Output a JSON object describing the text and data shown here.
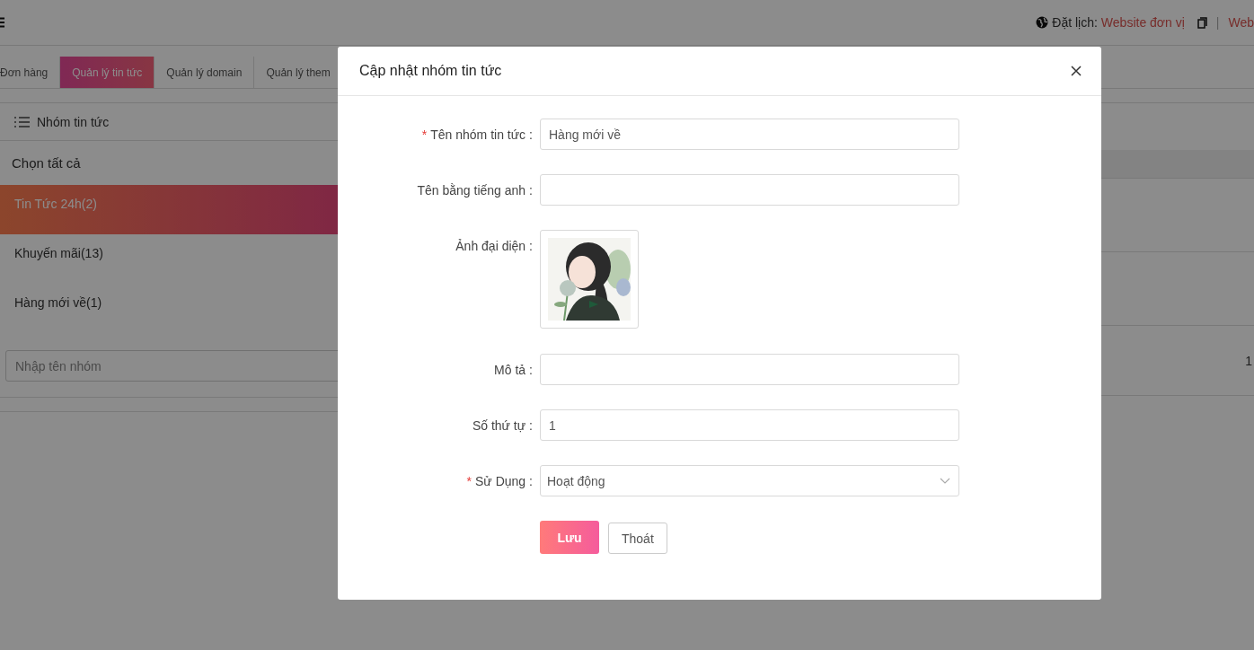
{
  "header": {
    "schedule_label": "Đặt lịch:",
    "schedule_link": "Website đơn vị",
    "separator": "|",
    "link_2": "Web"
  },
  "tabs": [
    {
      "label": "Đơn hàng",
      "selected": false
    },
    {
      "label": "Quản lý tin tức",
      "selected": true
    },
    {
      "label": "Quản lý domain",
      "selected": false
    },
    {
      "label": "Quản lý them",
      "selected": false
    }
  ],
  "sidebar": {
    "title": "Nhóm tin tức",
    "select_all": "Chọn tất cả",
    "items": [
      {
        "label": "Tin Tức 24h(2)",
        "selected": true
      },
      {
        "label": "Khuyến mãi(13)",
        "selected": false
      },
      {
        "label": "Hàng mới về(1)",
        "selected": false
      }
    ],
    "input": {
      "placeholder": "Nhập tên nhóm"
    }
  },
  "table": {
    "rows": [
      {},
      {},
      {
        "column_2": "1"
      }
    ]
  },
  "modal": {
    "title": "Cập nhật nhóm tin tức",
    "fields": [
      {
        "kind": "text",
        "required_mark": "*",
        "label": "Tên nhóm tin tức",
        "colon": ":",
        "value": "Hàng mới về"
      },
      {
        "kind": "text",
        "label": "Tên bằng tiếng anh",
        "colon": ":"
      },
      {
        "label": "Ảnh đại diện",
        "colon": ":"
      },
      {
        "kind": "text",
        "label": "Mô tả",
        "colon": ":"
      },
      {
        "kind": "text",
        "label": "Số thứ tự",
        "colon": ":",
        "value": "1"
      },
      {
        "kind": "select",
        "required_mark": "*",
        "label": "Sử Dụng",
        "colon": ":",
        "value": "Hoạt động"
      }
    ],
    "buttons": [
      {
        "label": "Lưu",
        "kind": "primary"
      },
      {
        "label": "Thoát",
        "kind": "default"
      }
    ]
  }
}
